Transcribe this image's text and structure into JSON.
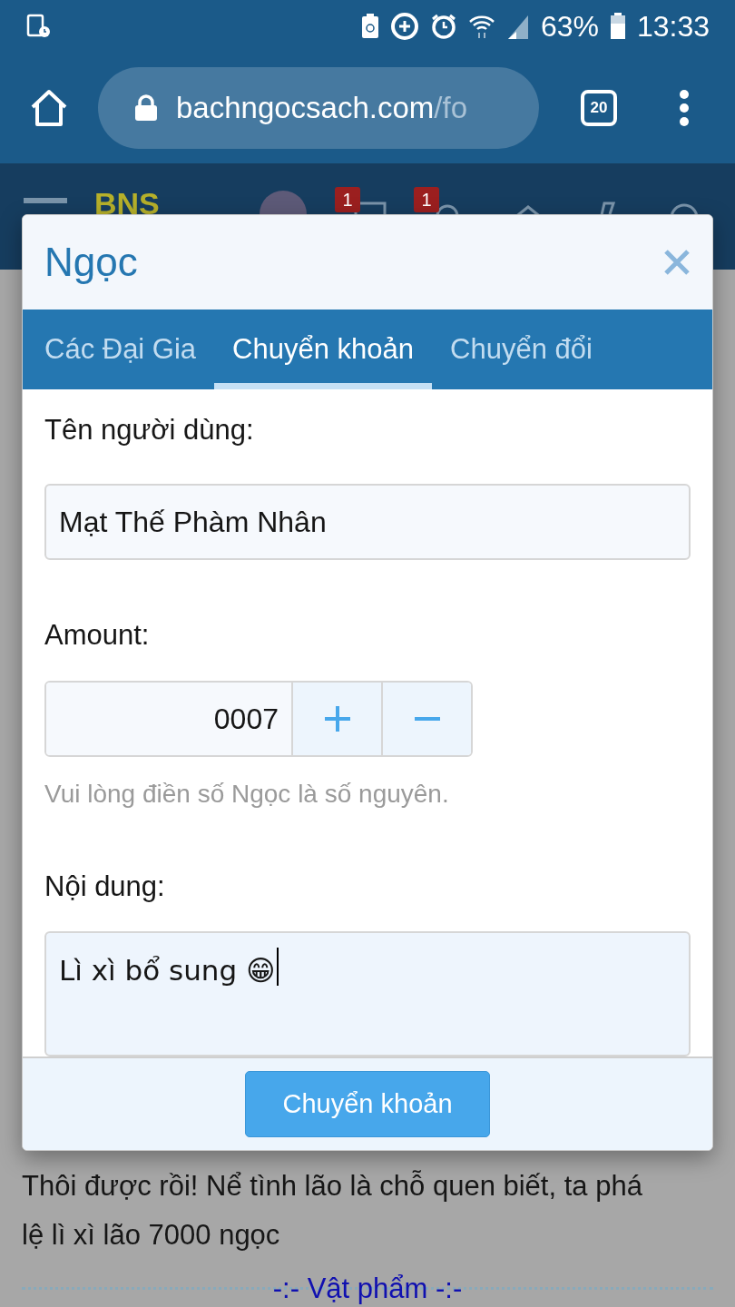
{
  "status_bar": {
    "battery": "63%",
    "time": "13:33"
  },
  "browser": {
    "url_host": "bachngocsach.com",
    "url_path": "/fo",
    "tab_count": "20"
  },
  "site_header": {
    "logo": "BNS",
    "badges": [
      "1",
      "1"
    ]
  },
  "dialog": {
    "title": "Ngọc",
    "tabs": [
      {
        "label": "Các Đại Gia",
        "selected": false
      },
      {
        "label": "Chuyển khoản",
        "selected": true
      },
      {
        "label": "Chuyển đổi",
        "selected": false
      }
    ],
    "username": {
      "label": "Tên người dùng:",
      "value": "Mạt Thế Phàm Nhân"
    },
    "amount": {
      "label": "Amount:",
      "value": "0007",
      "hint": "Vui lòng điền số Ngọc là số nguyên."
    },
    "content": {
      "label": "Nội dung:",
      "value": "Lì xì bổ sung 😁"
    },
    "submit": "Chuyển khoản"
  },
  "page": {
    "paragraph": "Thôi được rồi! Nể tình lão là chỗ quen biết, ta phá lệ lì xì lão 7000 ngọc",
    "link": "-:- Vật phẩm -:-"
  }
}
